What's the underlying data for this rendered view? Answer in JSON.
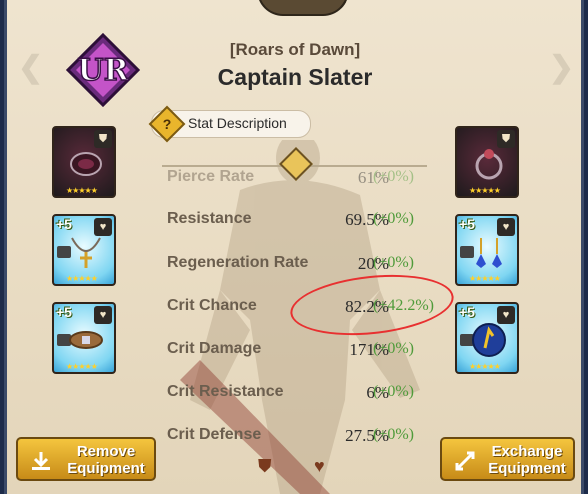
{
  "item": {
    "rarity": "UR",
    "subtitle": "[Roars of Dawn]",
    "name": "Captain Slater"
  },
  "stat_description_label": "Stat Description",
  "stats": [
    {
      "name": "Pierce Rate",
      "value": "61%",
      "bonus": "(+0%)",
      "faded": true
    },
    {
      "name": "Resistance",
      "value": "69.5%",
      "bonus": "(+0%)"
    },
    {
      "name": "Regeneration Rate",
      "value": "20%",
      "bonus": "(+0%)"
    },
    {
      "name": "Crit Chance",
      "value": "82.2%",
      "bonus": "(+42.2%)"
    },
    {
      "name": "Crit Damage",
      "value": "171%",
      "bonus": "(+0%)"
    },
    {
      "name": "Crit Resistance",
      "value": "6%",
      "bonus": "(+0%)"
    },
    {
      "name": "Crit Defense",
      "value": "27.5%",
      "bonus": "(+0%)"
    }
  ],
  "equipment_left": [
    {
      "name": "dark-bracer",
      "plus": "",
      "stars": "★★★★★"
    },
    {
      "name": "trident-necklace",
      "plus": "+5",
      "stars": "★★★★★"
    },
    {
      "name": "jeweled-belt",
      "plus": "+5",
      "stars": "★★★★★"
    }
  ],
  "equipment_right": [
    {
      "name": "dark-ring",
      "plus": "",
      "stars": "★★★★★"
    },
    {
      "name": "blue-earrings",
      "plus": "+5",
      "stars": "★★★★★"
    },
    {
      "name": "blue-rune",
      "plus": "+5",
      "stars": "★★★★★"
    }
  ],
  "buttons": {
    "remove": "Remove Equipment",
    "exchange": "Exchange Equipment"
  },
  "colors": {
    "bonus_green": "#4f9b3a",
    "gold_button": "#f4c53e",
    "annotation_red": "#e83030"
  }
}
